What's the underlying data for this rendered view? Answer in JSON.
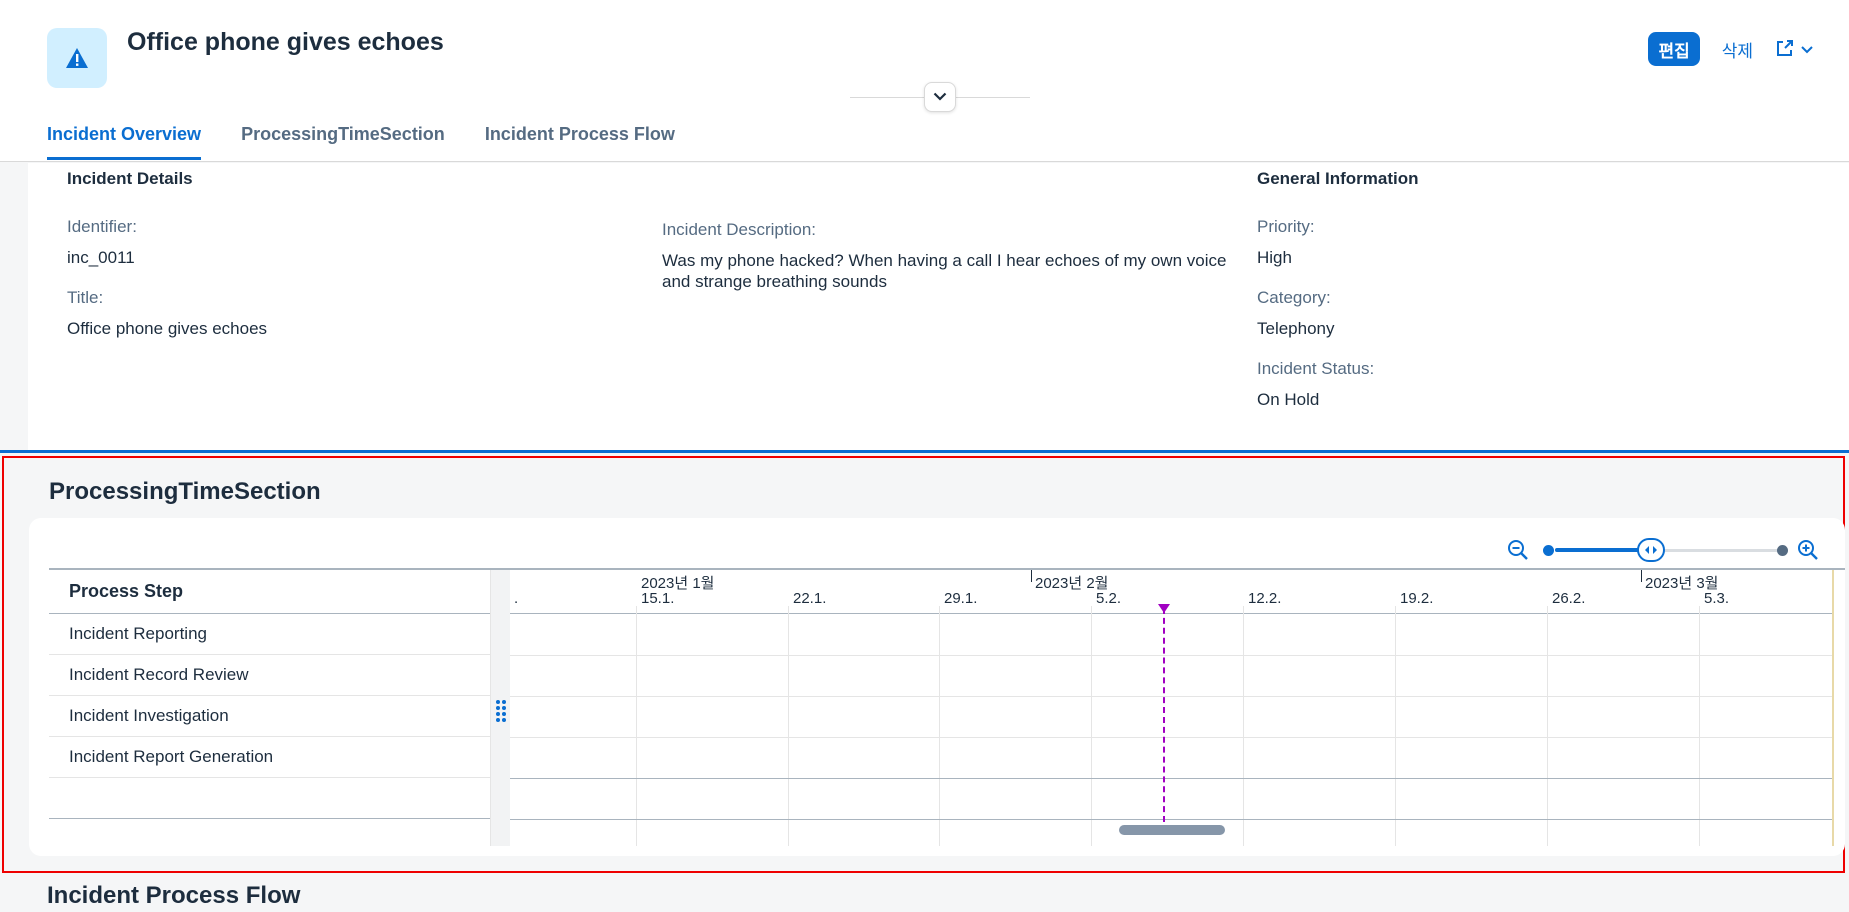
{
  "header": {
    "title": "Office phone gives echoes",
    "icon": "alert-triangle-icon",
    "actions": {
      "edit": "편집",
      "delete": "삭제",
      "share_icon": "share-icon"
    },
    "tabs": [
      {
        "label": "Incident Overview",
        "active": true
      },
      {
        "label": "ProcessingTimeSection",
        "active": false
      },
      {
        "label": "Incident Process Flow",
        "active": false
      }
    ]
  },
  "overview": {
    "details_title": "Incident Details",
    "general_title": "General Information",
    "identifier_label": "Identifier:",
    "identifier_value": "inc_0011",
    "title_label": "Title:",
    "title_value": "Office phone gives echoes",
    "description_label": "Incident Description:",
    "description_value": "Was my phone hacked? When having a call I hear echoes of my own voice and strange breathing sounds",
    "priority_label": "Priority:",
    "priority_value": "High",
    "category_label": "Category:",
    "category_value": "Telephony",
    "status_label": "Incident Status:",
    "status_value": "On Hold"
  },
  "processing": {
    "section_title": "ProcessingTimeSection",
    "table_header": "Process Step",
    "steps": [
      "Incident Reporting",
      "Incident Record Review",
      "Incident Investigation",
      "Incident Report Generation"
    ],
    "months": [
      "2023년 1월",
      "2023년 2월",
      "2023년 3월"
    ],
    "weeks": [
      ".",
      "15.1.",
      "22.1.",
      "29.1.",
      "5.2.",
      "12.2.",
      "19.2.",
      "26.2.",
      "5.3."
    ],
    "zoom_level_fraction": 0.43,
    "colors": {
      "accent": "#0a6ed1",
      "today": "#a100c2"
    }
  },
  "flow": {
    "section_title": "Incident Process Flow"
  }
}
